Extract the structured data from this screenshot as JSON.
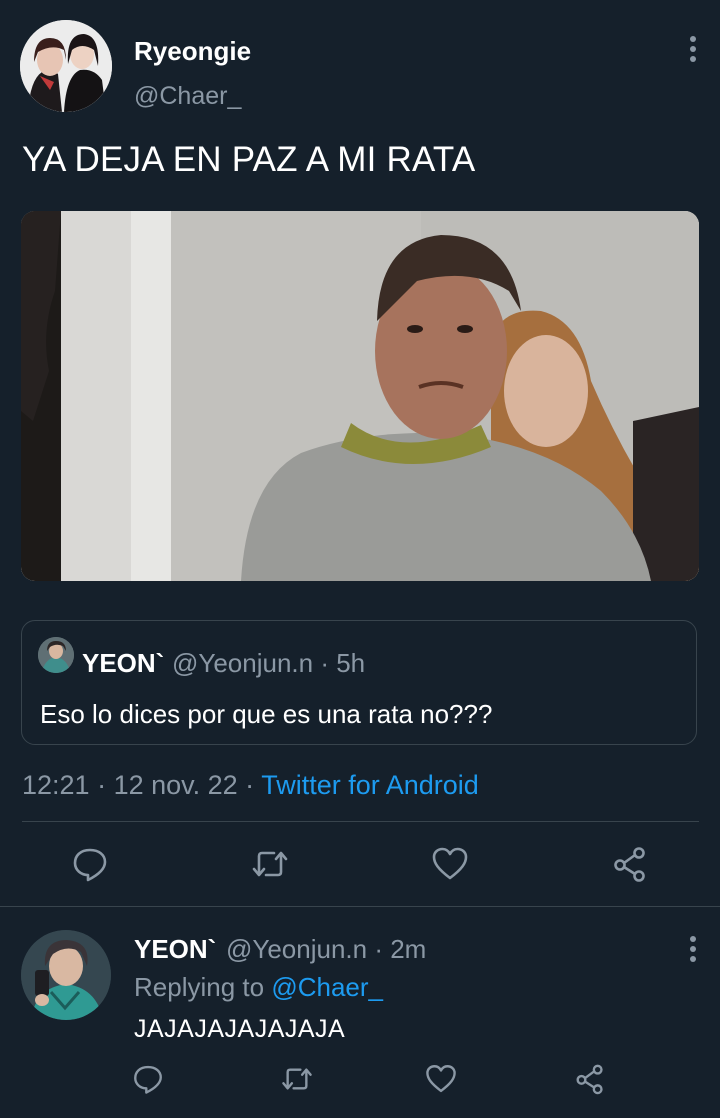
{
  "tweet": {
    "display_name": "Ryeongie",
    "handle": "@Chaer_",
    "text": "YA DEJA EN PAZ A MI RATA",
    "quoted": {
      "display_name": "YEON`",
      "meta": "@Yeonjun.n · 5h",
      "text": "Eso lo dices por que es una rata no???"
    },
    "time": "12:21",
    "date": "· 12 nov. 22 ·",
    "source": "Twitter for Android"
  },
  "reply": {
    "display_name": "YEON`",
    "meta": "@Yeonjun.n · 2m",
    "replying_prefix": "Replying to",
    "replying_to": "@Chaer_",
    "text": "JAJAJAJAJAJAJA"
  },
  "icons": [
    "more-vertical-icon",
    "reply-icon",
    "retweet-icon",
    "like-icon",
    "share-icon"
  ],
  "colors": {
    "background": "#15202b",
    "secondary_text": "#8b98a5",
    "accent": "#1d9bf0",
    "border": "#38444d"
  }
}
